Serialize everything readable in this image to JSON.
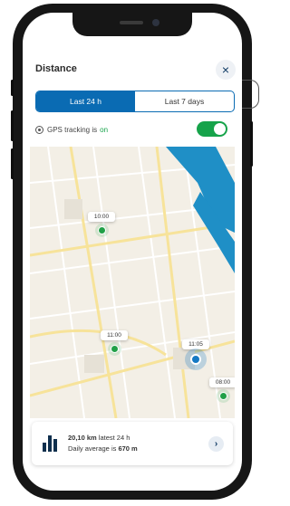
{
  "header": {
    "title": "Distance",
    "close_icon": "×"
  },
  "segments": {
    "active_label": "Last 24 h",
    "inactive_label": "Last 7 days"
  },
  "gps": {
    "prefix": "GPS tracking is",
    "status": "on",
    "enabled": true
  },
  "map": {
    "pins": [
      {
        "time": "10:00"
      },
      {
        "time": "11:00"
      },
      {
        "time": "11:05"
      },
      {
        "time": "08:00"
      }
    ],
    "colors": {
      "water": "#1f8fc6",
      "road": "#f7e39a",
      "land": "#f3efe6"
    }
  },
  "summary": {
    "distance": "20,10 km",
    "distance_suffix": "latest 24 h",
    "avg_prefix": "Daily average is",
    "avg_value": "670 m",
    "next_icon": "›"
  },
  "colors": {
    "accent": "#0a6bb3",
    "toggle_on": "#16a34a",
    "pin": "#21a047"
  }
}
